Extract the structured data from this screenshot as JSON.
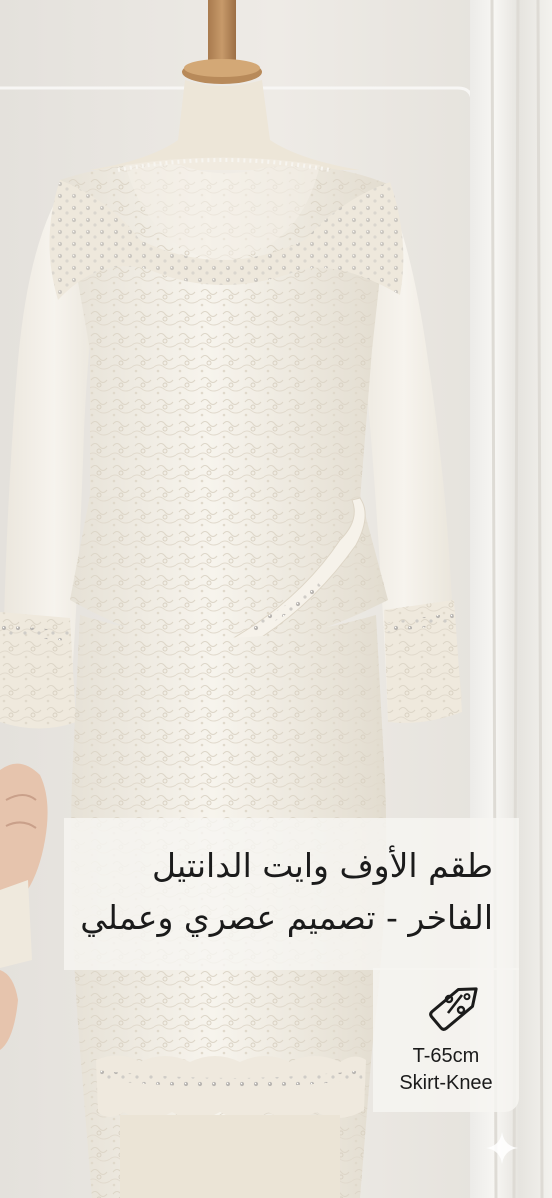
{
  "title": {
    "line1": "طقم الأوف وايت الدانتيل",
    "line2": "الفاخر - تصميم عصري وعملي"
  },
  "specs": {
    "icon": "discount-tag-icon",
    "length": "T-65cm",
    "skirt": "Skirt-Knee"
  },
  "decorations": {
    "corner_icon": "sparkle-icon"
  },
  "colors": {
    "fabric": "#f3efe6",
    "background": "#e9e6e1",
    "text": "#1b1b1b"
  }
}
